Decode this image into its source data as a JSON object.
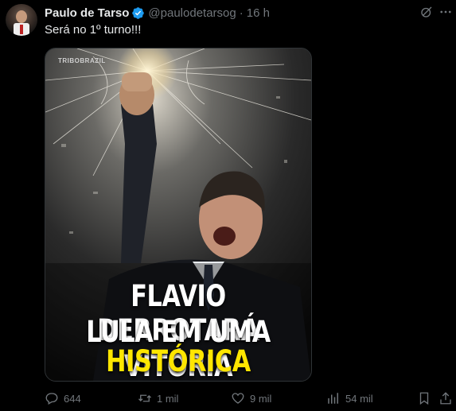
{
  "author": {
    "name": "Paulo de Tarso",
    "handle": "@paulodetarsog",
    "separator": "·",
    "time": "16 h"
  },
  "tweet": {
    "text": "Será no 1º turno!!!"
  },
  "media": {
    "watermark": "TRIBOBRAZIL",
    "caption_line1": "FLAVIO DERROTARÁ",
    "caption_line2": "LULA EM UMA VITÓRIA",
    "caption_line3": "HISTÓRICA",
    "caption_highlight_color": "#ffe600"
  },
  "actions": {
    "replies": "644",
    "reposts": "1 mil",
    "likes": "9 mil",
    "views": "54 mil"
  },
  "colors": {
    "background": "#000000",
    "text": "#e7e9ea",
    "muted": "#71767b",
    "verified": "#1d9bf0"
  }
}
